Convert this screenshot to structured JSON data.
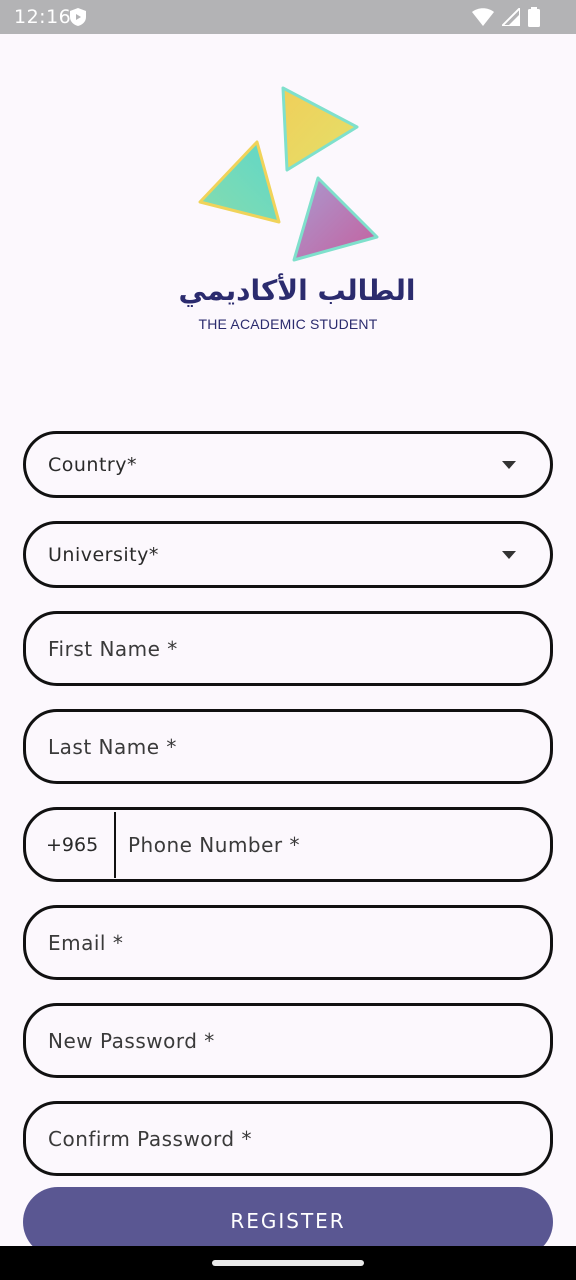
{
  "status_bar": {
    "time": "12:16",
    "icons": [
      "shield-icon",
      "wifi-icon",
      "signal-icon",
      "battery-icon"
    ]
  },
  "brand": {
    "name_ar": "الطالب الأكاديمي",
    "name_en": "THE ACADEMIC STUDENT",
    "logo_colors": [
      "#f2d35c",
      "#6fd8c4",
      "#b56aa6"
    ]
  },
  "form": {
    "country": "Country*",
    "university": "University*",
    "first_name": "First Name *",
    "last_name": "Last Name *",
    "phone_prefix": "+965",
    "phone": "Phone Number *",
    "email": "Email *",
    "new_password": "New Password *",
    "confirm_password": "Confirm Password *",
    "register": "REGISTER"
  },
  "colors": {
    "primary": "#5a5792",
    "background": "#fcf8fd"
  }
}
